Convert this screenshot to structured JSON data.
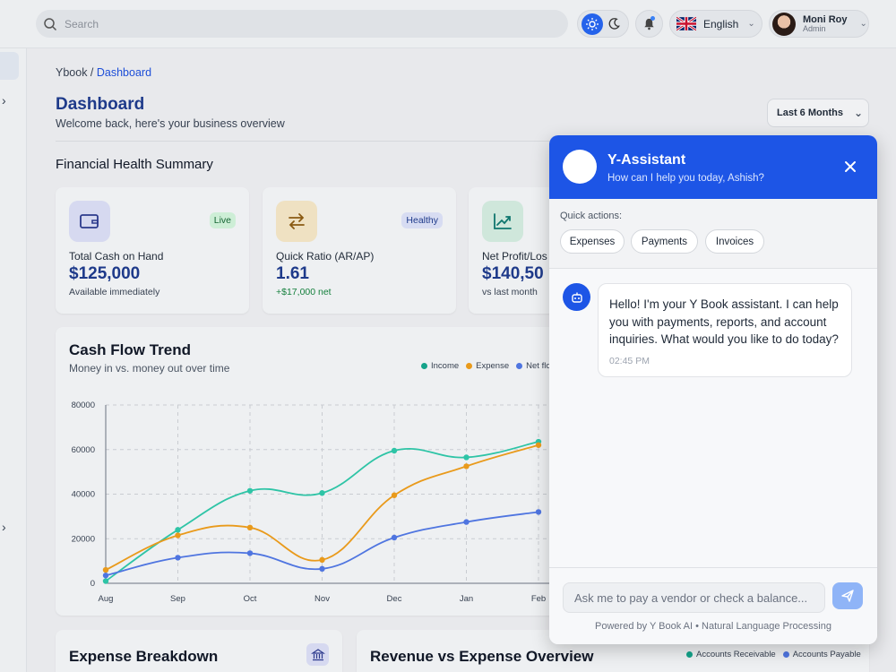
{
  "search": {
    "placeholder": "Search"
  },
  "language": {
    "label": "English"
  },
  "user": {
    "name": "Moni Roy",
    "role": "Admin"
  },
  "breadcrumb": {
    "root": "Ybook",
    "separator": " / ",
    "current": "Dashboard"
  },
  "header": {
    "title": "Dashboard",
    "subtitle": "Welcome back, here's your business overview"
  },
  "period_select": {
    "value": "Last 6 Months"
  },
  "financial_health": {
    "title": "Financial Health Summary",
    "cards": [
      {
        "label": "Total Cash on Hand",
        "value": "$125,000",
        "note": "Available immediately",
        "badge": "Live",
        "icon": "wallet-icon"
      },
      {
        "label": "Quick Ratio (AR/AP)",
        "value": "1.61",
        "note": "+$17,000 net",
        "badge": "Healthy",
        "icon": "arrows-exchange-icon"
      },
      {
        "label": "Net Profit/Los",
        "value": "$140,50",
        "note": "vs last month",
        "icon": "trend-up-icon"
      }
    ]
  },
  "cash_flow": {
    "title": "Cash Flow Trend",
    "subtitle": "Money in vs. money out over time",
    "legend": [
      "Income",
      "Expense",
      "Net flo"
    ]
  },
  "chart_data": {
    "type": "line",
    "categories": [
      "Aug",
      "Sep",
      "Oct",
      "Nov",
      "Dec",
      "Jan",
      "Feb"
    ],
    "series": [
      {
        "name": "Income",
        "color": "#2ec4a6",
        "values": [
          1000,
          24000,
          41500,
          40500,
          59500,
          56500,
          63500
        ]
      },
      {
        "name": "Expense",
        "color": "#e99a1b",
        "values": [
          6000,
          21500,
          25000,
          10500,
          39500,
          52500,
          62000
        ]
      },
      {
        "name": "Net flo",
        "color": "#4f75e0",
        "values": [
          3500,
          11500,
          13500,
          6500,
          20500,
          27500,
          32000
        ]
      }
    ],
    "y_ticks": [
      "0",
      "20000",
      "40000",
      "60000",
      "80000"
    ],
    "ylim": [
      0,
      80000
    ],
    "grid": true
  },
  "bottom": {
    "expense_title": "Expense Breakdown",
    "revenue_title": "Revenue vs Expense Overview",
    "revenue_legend": [
      "Accounts Receivable",
      "Accounts Payable"
    ]
  },
  "assistant": {
    "title": "Y-Assistant",
    "subtitle": "How can I help you today, Ashish?",
    "quick_label": "Quick actions:",
    "quick_actions": [
      "Expenses",
      "Payments",
      "Invoices"
    ],
    "message": "Hello! I'm your Y Book assistant. I can help you with payments, reports, and account inquiries. What would you like to do today?",
    "time": "02:45 PM",
    "input_placeholder": "Ask me to pay a vendor or check a balance...",
    "powered": "Powered by Y Book AI • Natural Language Processing"
  },
  "colors": {
    "primary": "#1d55e6",
    "title_blue": "#1e3a8a",
    "live_badge": "#cdeed6",
    "healthy_badge": "#d7dcf2"
  }
}
